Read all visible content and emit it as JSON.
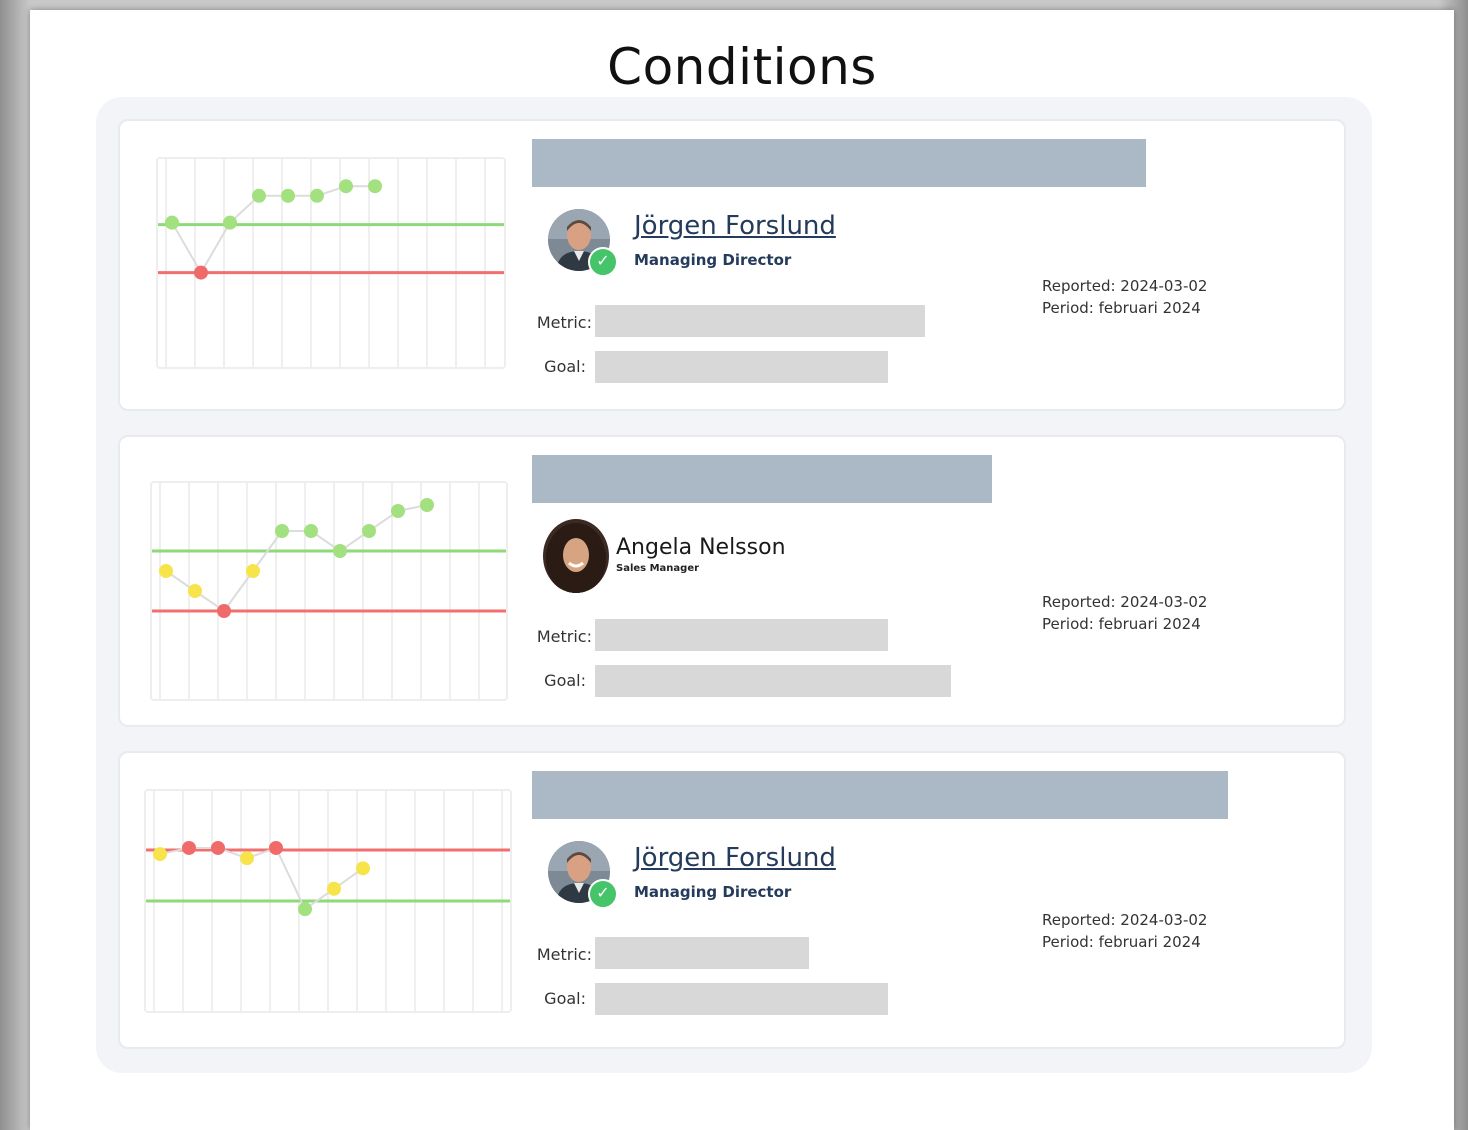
{
  "page": {
    "title": "Conditions"
  },
  "conditions": [
    {
      "person": {
        "name": "Jörgen Forslund",
        "role": "Managing Director",
        "linked": true,
        "verified": true
      },
      "fields": {
        "metric_label": "Metric:",
        "goal_label": "Goal:"
      },
      "meta": {
        "reported": "Reported: 2024-03-02",
        "period": "Period: februari 2024"
      },
      "chart_data": {
        "type": "line",
        "upper_threshold": {
          "color": "#8fd97a",
          "level": 70
        },
        "lower_threshold": {
          "color": "#f07070",
          "level": 45
        },
        "points": [
          {
            "y": 71,
            "status": "green"
          },
          {
            "y": 45,
            "status": "red"
          },
          {
            "y": 71,
            "status": "green"
          },
          {
            "y": 85,
            "status": "green"
          },
          {
            "y": 85,
            "status": "green"
          },
          {
            "y": 85,
            "status": "green"
          },
          {
            "y": 90,
            "status": "green"
          },
          {
            "y": 90,
            "status": "green"
          }
        ]
      }
    },
    {
      "person": {
        "name": "Angela Nelsson",
        "role": "Sales Manager",
        "linked": false,
        "verified": false
      },
      "fields": {
        "metric_label": "Metric:",
        "goal_label": "Goal:"
      },
      "meta": {
        "reported": "Reported: 2024-03-02",
        "period": "Period: februari 2024"
      },
      "chart_data": {
        "type": "line",
        "upper_threshold": {
          "color": "#8fd97a",
          "level": 70
        },
        "lower_threshold": {
          "color": "#f07070",
          "level": 40
        },
        "points": [
          {
            "y": 60,
            "status": "yellow"
          },
          {
            "y": 50,
            "status": "yellow"
          },
          {
            "y": 40,
            "status": "red"
          },
          {
            "y": 60,
            "status": "yellow"
          },
          {
            "y": 80,
            "status": "green"
          },
          {
            "y": 80,
            "status": "green"
          },
          {
            "y": 70,
            "status": "green"
          },
          {
            "y": 80,
            "status": "green"
          },
          {
            "y": 90,
            "status": "green"
          },
          {
            "y": 93,
            "status": "green"
          }
        ]
      }
    },
    {
      "person": {
        "name": "Jörgen Forslund",
        "role": "Managing Director",
        "linked": true,
        "verified": true
      },
      "fields": {
        "metric_label": "Metric:",
        "goal_label": "Goal:"
      },
      "meta": {
        "reported": "Reported: 2024-03-02",
        "period": "Period: februari 2024"
      },
      "chart_data": {
        "type": "line",
        "upper_threshold": {
          "color": "#f07070",
          "level": 75
        },
        "lower_threshold": {
          "color": "#8fd97a",
          "level": 50
        },
        "points": [
          {
            "y": 73,
            "status": "yellow"
          },
          {
            "y": 76,
            "status": "red"
          },
          {
            "y": 76,
            "status": "red"
          },
          {
            "y": 71,
            "status": "yellow"
          },
          {
            "y": 76,
            "status": "red"
          },
          {
            "y": 46,
            "status": "green"
          },
          {
            "y": 56,
            "status": "yellow"
          },
          {
            "y": 66,
            "status": "yellow"
          }
        ]
      }
    }
  ],
  "colors": {
    "green": "#a3e07f",
    "red": "#f06a6a",
    "yellow": "#f7e44a",
    "link": "#253b5c",
    "title_bar": "#abb8c6",
    "field_box": "#d8d8d8"
  }
}
